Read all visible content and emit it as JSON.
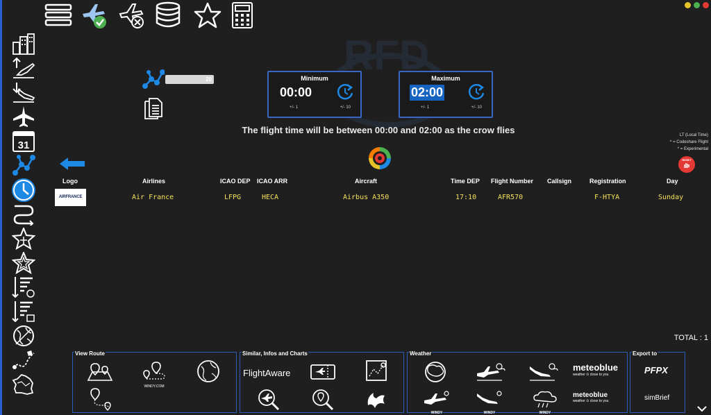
{
  "toolbar": {
    "icons": [
      "menu-icon",
      "plane-check-icon",
      "plane-cancel-icon",
      "database-icon",
      "star-icon",
      "calculator-icon"
    ]
  },
  "sidebar": {
    "icons": [
      "buildings-icon",
      "departure-icon",
      "arrival-icon",
      "airplane-icon",
      "calendar-icon",
      "network-icon",
      "clock-icon",
      "route-icon",
      "star-plane-icon",
      "star-outline-icon",
      "filter-sort-icon",
      "filter-sort-calendar-icon",
      "globe-icon",
      "map-route-icon",
      "france-map-icon"
    ],
    "calendar_day": "31",
    "active": "clock-icon"
  },
  "distance_slider": {
    "value": "20"
  },
  "minimum": {
    "label": "Minimum",
    "value": "00:00",
    "small_step": "+/- 1",
    "large_step": "+/- 10"
  },
  "maximum": {
    "label": "Maximum",
    "value": "02:00",
    "small_step": "+/- 1",
    "large_step": "+/- 10"
  },
  "info_text": "The flight time will be between 00:00 and 02:00 as the crow flies",
  "legend": [
    "LT (Local Time)",
    "^ = Codeshare Flight",
    "* = Experimental"
  ],
  "reset_label": "RESET",
  "table": {
    "headers": {
      "logo": "Logo",
      "airlines": "Airlines",
      "icao_dep": "ICAO DEP",
      "icao_arr": "ICAO ARR",
      "aircraft": "Aircraft",
      "time_dep": "Time DEP",
      "flight_number": "Flight Number",
      "callsign": "Callsign",
      "registration": "Registration",
      "day": "Day"
    },
    "rows": [
      {
        "logo_text": "AIRFRANCE",
        "airline": "Air France",
        "icao_dep": "LFPG",
        "icao_arr": "HECA",
        "aircraft": "Airbus A350",
        "time_dep": "17:10",
        "flight_number": "AFR570",
        "callsign": "",
        "registration": "F-HTYA",
        "day": "Sunday"
      }
    ]
  },
  "total": "TOTAL : 1",
  "panels": {
    "view_route": {
      "title": "View Route",
      "windy_label": "WINDY.COM"
    },
    "similar": {
      "title": "Similar, Infos and Charts",
      "flightaware_label": "FlightAware"
    },
    "weather": {
      "title": "Weather",
      "windy_label": "WINDY",
      "meteoblue_label": "meteoblue",
      "meteoblue_tagline": "weather ⊙ close to you"
    },
    "export": {
      "title": "Export to",
      "pfpx_label": "PFPX",
      "simbrief_label": "simBrief"
    }
  },
  "watermark_text": "RFD",
  "colors": {
    "accent": "#1e88e5",
    "panel_border": "#2d5bb8",
    "data_text": "#f3e05a",
    "background": "#1f1f1f"
  }
}
